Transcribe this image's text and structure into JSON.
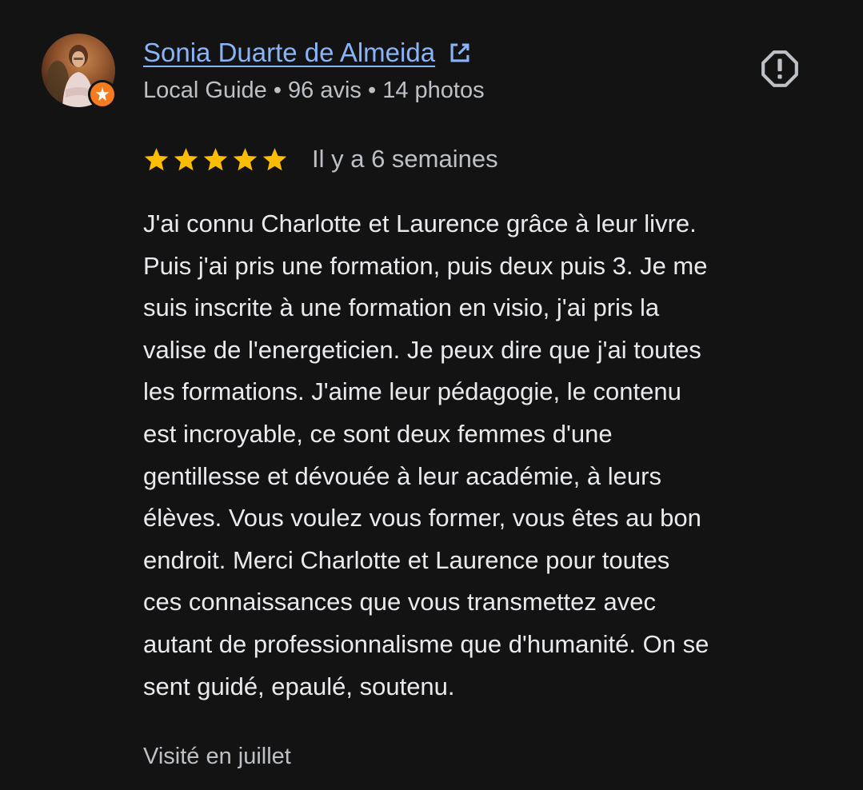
{
  "reviewer": {
    "name": "Sonia Duarte de Almeida",
    "meta": "Local Guide • 96 avis • 14 photos",
    "avatar_icon": "user-photo-avatar",
    "badge_icon": "local-guide-star-badge"
  },
  "review": {
    "rating": 5,
    "max_rating": 5,
    "date": "Il y a 6 semaines",
    "text": "J'ai connu Charlotte et Laurence grâce à leur livre.\nPuis j'ai pris une formation, puis deux puis 3. Je me\nsuis inscrite à une formation en visio, j'ai pris la\nvalise de l'energeticien. Je peux dire que j'ai toutes\nles formations. J'aime leur pédagogie, le contenu\nest incroyable, ce sont deux femmes d'une\ngentillesse et dévouée à leur académie, à leurs\nélèves. Vous voulez vous former, vous êtes au bon\nendroit. Merci Charlotte et Laurence pour toutes\nces connaissances que vous transmettez avec\nautant de professionnalisme que d'humanité. On se\nsent guidé, epaulé, soutenu.",
    "visited": "Visité en juillet"
  },
  "icons": {
    "open_link": "open-in-new-icon",
    "report": "report-icon",
    "star": "star-icon"
  },
  "colors": {
    "background": "#131313",
    "link": "#8ab4f8",
    "star": "#fbbc04",
    "badge": "#f47b20",
    "secondary_text": "#bdc1c6",
    "primary_text": "#e8eaed"
  }
}
